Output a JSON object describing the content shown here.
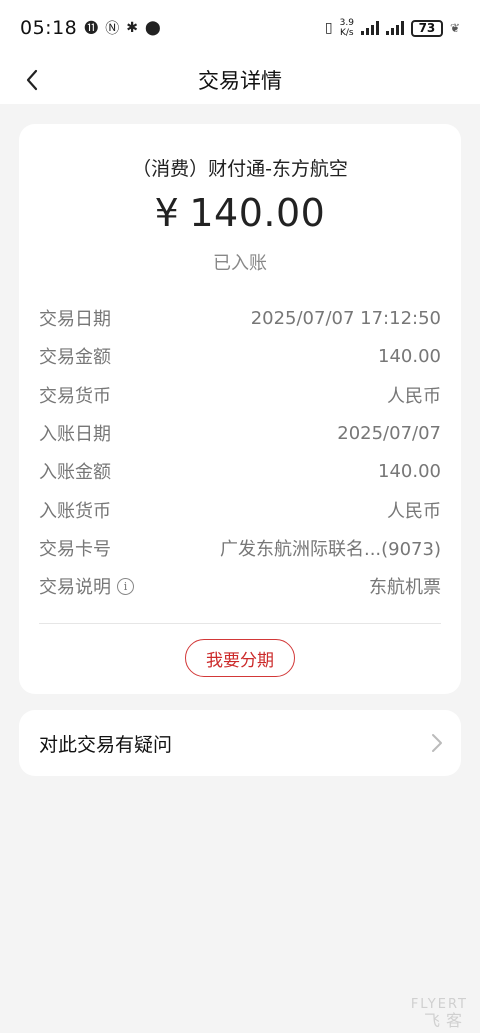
{
  "status_bar": {
    "time": "05:18",
    "net_speed_value": "3.9",
    "net_speed_unit": "K/s",
    "battery": "73"
  },
  "nav": {
    "title": "交易详情"
  },
  "transaction": {
    "merchant": "（消费）财付通-东方航空",
    "currency_symbol": "¥",
    "amount": "140.00",
    "status": "已入账",
    "rows": [
      {
        "label": "交易日期",
        "value": "2025/07/07 17:12:50"
      },
      {
        "label": "交易金额",
        "value": "140.00"
      },
      {
        "label": "交易货币",
        "value": "人民币"
      },
      {
        "label": "入账日期",
        "value": "2025/07/07"
      },
      {
        "label": "入账金额",
        "value": "140.00"
      },
      {
        "label": "入账货币",
        "value": "人民币"
      },
      {
        "label": "交易卡号",
        "value": "广发东航洲际联名...(9073)"
      },
      {
        "label": "交易说明",
        "value": "东航机票"
      }
    ],
    "installment_label": "我要分期"
  },
  "question": {
    "label": "对此交易有疑问"
  },
  "watermark": {
    "brand": "FLYERT",
    "cn": "飞客"
  },
  "icons": {
    "back": "chevron-left-icon",
    "info": "info-icon",
    "chevron": "chevron-right-icon"
  },
  "colors": {
    "accent_red": "#d23838",
    "background": "#f4f4f4"
  }
}
